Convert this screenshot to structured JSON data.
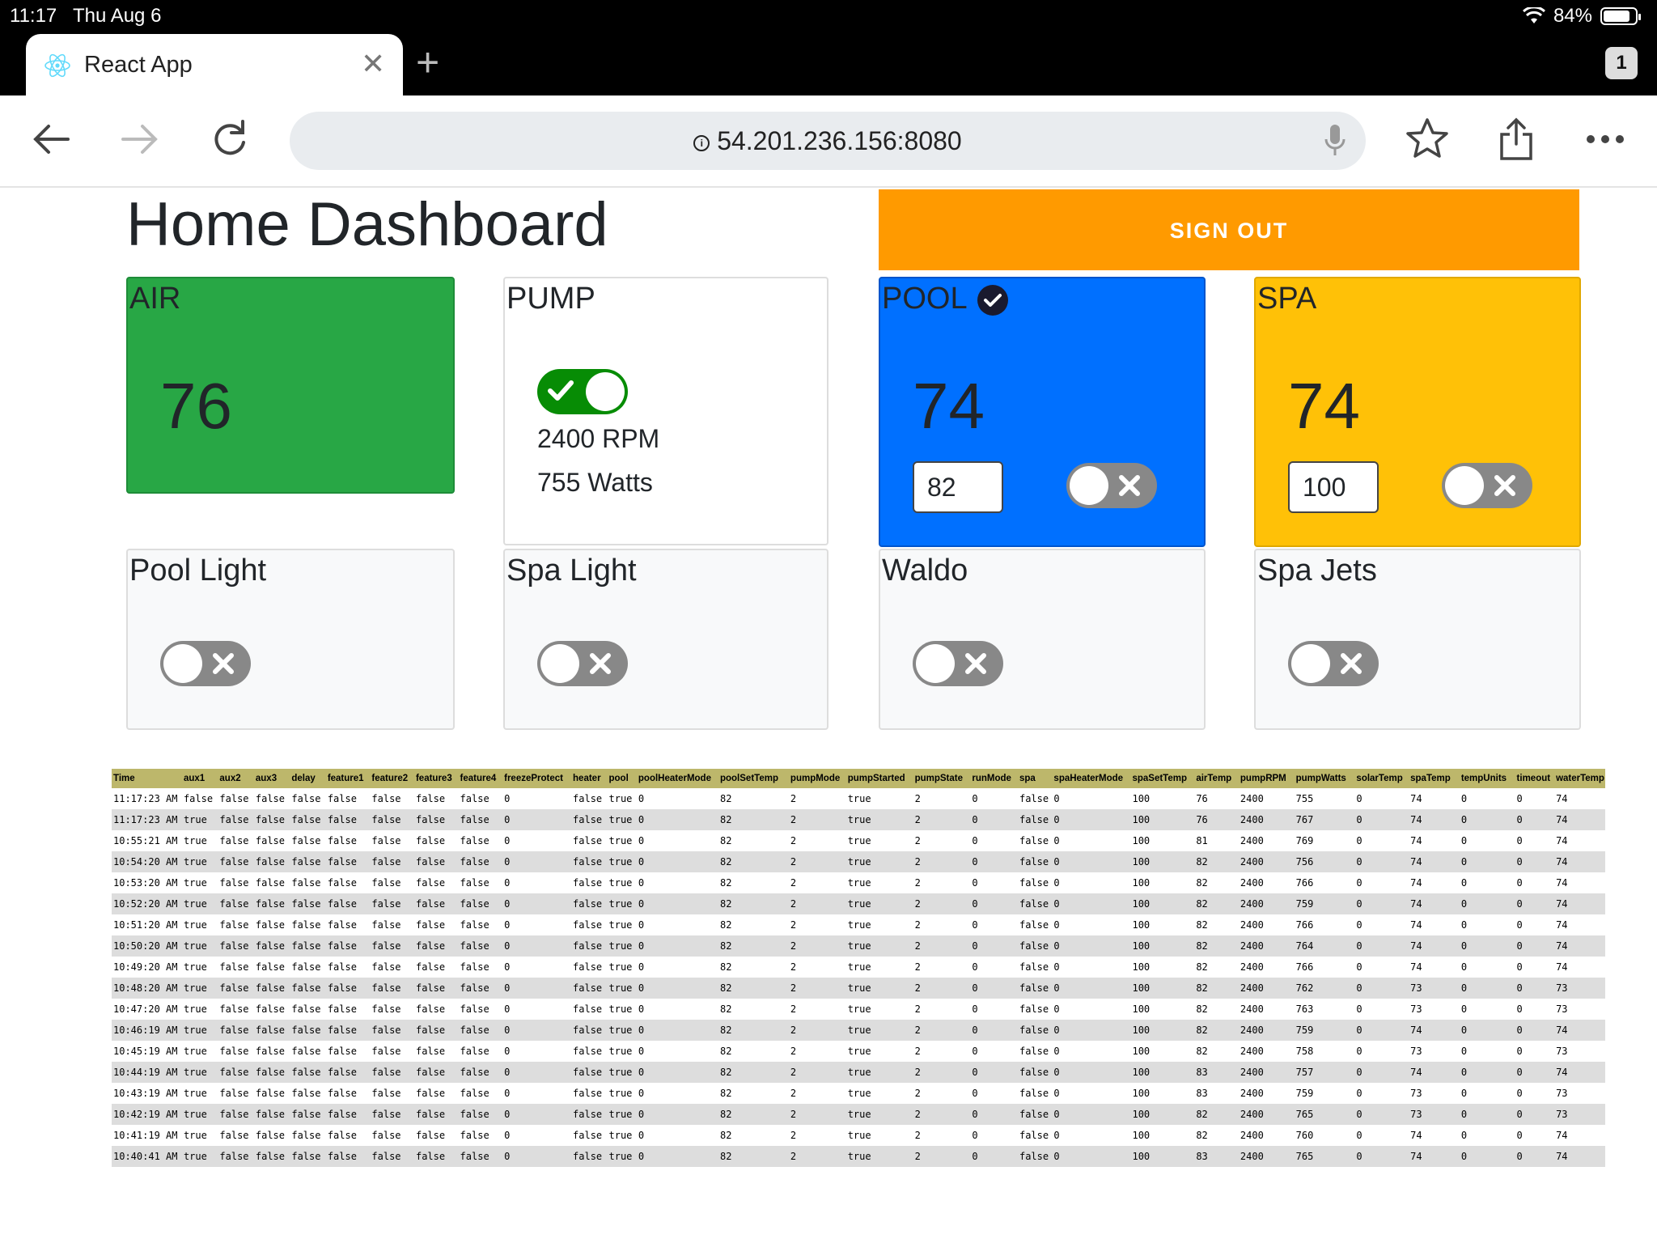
{
  "status_bar": {
    "time": "11:17",
    "date": "Thu Aug 6",
    "battery": "84%"
  },
  "browser": {
    "tab_title": "React App",
    "tab_count": "1",
    "url": "54.201.236.156:8080"
  },
  "page": {
    "title": "Home Dashboard",
    "signout_label": "SIGN OUT"
  },
  "cards": {
    "air": {
      "label": "AIR",
      "temp": "76",
      "color": "#28a745"
    },
    "pump": {
      "label": "PUMP",
      "on": true,
      "rpm": "2400 RPM",
      "watts": "755 Watts"
    },
    "pool": {
      "label": "POOL",
      "temp": "74",
      "set_temp": "82",
      "on": false,
      "active": true,
      "color": "#0070ff"
    },
    "spa": {
      "label": "SPA",
      "temp": "74",
      "set_temp": "100",
      "on": false,
      "color": "#ffc107"
    },
    "pool_light": {
      "label": "Pool Light",
      "on": false
    },
    "spa_light": {
      "label": "Spa Light",
      "on": false
    },
    "waldo": {
      "label": "Waldo",
      "on": false
    },
    "spa_jets": {
      "label": "Spa Jets",
      "on": false
    }
  },
  "history": {
    "columns": [
      "Time",
      "aux1",
      "aux2",
      "aux3",
      "delay",
      "feature1",
      "feature2",
      "feature3",
      "feature4",
      "freezeProtect",
      "heater",
      "pool",
      "poolHeaterMode",
      "poolSetTemp",
      "pumpMode",
      "pumpStarted",
      "pumpState",
      "runMode",
      "spa",
      "spaHeaterMode",
      "spaSetTemp",
      "airTemp",
      "pumpRPM",
      "pumpWatts",
      "solarTemp",
      "spaTemp",
      "tempUnits",
      "timeout",
      "waterTemp"
    ],
    "rows": [
      [
        "11:17:23 AM",
        "false",
        "false",
        "false",
        "false",
        "false",
        "false",
        "false",
        "false",
        "0",
        "false",
        "true",
        "0",
        "82",
        "2",
        "true",
        "2",
        "0",
        "false",
        "0",
        "100",
        "76",
        "2400",
        "755",
        "0",
        "74",
        "0",
        "0",
        "74"
      ],
      [
        "11:17:23 AM",
        "true",
        "false",
        "false",
        "false",
        "false",
        "false",
        "false",
        "false",
        "0",
        "false",
        "true",
        "0",
        "82",
        "2",
        "true",
        "2",
        "0",
        "false",
        "0",
        "100",
        "76",
        "2400",
        "767",
        "0",
        "74",
        "0",
        "0",
        "74"
      ],
      [
        "10:55:21 AM",
        "true",
        "false",
        "false",
        "false",
        "false",
        "false",
        "false",
        "false",
        "0",
        "false",
        "true",
        "0",
        "82",
        "2",
        "true",
        "2",
        "0",
        "false",
        "0",
        "100",
        "81",
        "2400",
        "769",
        "0",
        "74",
        "0",
        "0",
        "74"
      ],
      [
        "10:54:20 AM",
        "true",
        "false",
        "false",
        "false",
        "false",
        "false",
        "false",
        "false",
        "0",
        "false",
        "true",
        "0",
        "82",
        "2",
        "true",
        "2",
        "0",
        "false",
        "0",
        "100",
        "82",
        "2400",
        "756",
        "0",
        "74",
        "0",
        "0",
        "74"
      ],
      [
        "10:53:20 AM",
        "true",
        "false",
        "false",
        "false",
        "false",
        "false",
        "false",
        "false",
        "0",
        "false",
        "true",
        "0",
        "82",
        "2",
        "true",
        "2",
        "0",
        "false",
        "0",
        "100",
        "82",
        "2400",
        "766",
        "0",
        "74",
        "0",
        "0",
        "74"
      ],
      [
        "10:52:20 AM",
        "true",
        "false",
        "false",
        "false",
        "false",
        "false",
        "false",
        "false",
        "0",
        "false",
        "true",
        "0",
        "82",
        "2",
        "true",
        "2",
        "0",
        "false",
        "0",
        "100",
        "82",
        "2400",
        "759",
        "0",
        "74",
        "0",
        "0",
        "74"
      ],
      [
        "10:51:20 AM",
        "true",
        "false",
        "false",
        "false",
        "false",
        "false",
        "false",
        "false",
        "0",
        "false",
        "true",
        "0",
        "82",
        "2",
        "true",
        "2",
        "0",
        "false",
        "0",
        "100",
        "82",
        "2400",
        "766",
        "0",
        "74",
        "0",
        "0",
        "74"
      ],
      [
        "10:50:20 AM",
        "true",
        "false",
        "false",
        "false",
        "false",
        "false",
        "false",
        "false",
        "0",
        "false",
        "true",
        "0",
        "82",
        "2",
        "true",
        "2",
        "0",
        "false",
        "0",
        "100",
        "82",
        "2400",
        "764",
        "0",
        "74",
        "0",
        "0",
        "74"
      ],
      [
        "10:49:20 AM",
        "true",
        "false",
        "false",
        "false",
        "false",
        "false",
        "false",
        "false",
        "0",
        "false",
        "true",
        "0",
        "82",
        "2",
        "true",
        "2",
        "0",
        "false",
        "0",
        "100",
        "82",
        "2400",
        "766",
        "0",
        "74",
        "0",
        "0",
        "74"
      ],
      [
        "10:48:20 AM",
        "true",
        "false",
        "false",
        "false",
        "false",
        "false",
        "false",
        "false",
        "0",
        "false",
        "true",
        "0",
        "82",
        "2",
        "true",
        "2",
        "0",
        "false",
        "0",
        "100",
        "82",
        "2400",
        "762",
        "0",
        "73",
        "0",
        "0",
        "73"
      ],
      [
        "10:47:20 AM",
        "true",
        "false",
        "false",
        "false",
        "false",
        "false",
        "false",
        "false",
        "0",
        "false",
        "true",
        "0",
        "82",
        "2",
        "true",
        "2",
        "0",
        "false",
        "0",
        "100",
        "82",
        "2400",
        "763",
        "0",
        "73",
        "0",
        "0",
        "73"
      ],
      [
        "10:46:19 AM",
        "true",
        "false",
        "false",
        "false",
        "false",
        "false",
        "false",
        "false",
        "0",
        "false",
        "true",
        "0",
        "82",
        "2",
        "true",
        "2",
        "0",
        "false",
        "0",
        "100",
        "82",
        "2400",
        "759",
        "0",
        "74",
        "0",
        "0",
        "74"
      ],
      [
        "10:45:19 AM",
        "true",
        "false",
        "false",
        "false",
        "false",
        "false",
        "false",
        "false",
        "0",
        "false",
        "true",
        "0",
        "82",
        "2",
        "true",
        "2",
        "0",
        "false",
        "0",
        "100",
        "82",
        "2400",
        "758",
        "0",
        "73",
        "0",
        "0",
        "73"
      ],
      [
        "10:44:19 AM",
        "true",
        "false",
        "false",
        "false",
        "false",
        "false",
        "false",
        "false",
        "0",
        "false",
        "true",
        "0",
        "82",
        "2",
        "true",
        "2",
        "0",
        "false",
        "0",
        "100",
        "83",
        "2400",
        "757",
        "0",
        "74",
        "0",
        "0",
        "74"
      ],
      [
        "10:43:19 AM",
        "true",
        "false",
        "false",
        "false",
        "false",
        "false",
        "false",
        "false",
        "0",
        "false",
        "true",
        "0",
        "82",
        "2",
        "true",
        "2",
        "0",
        "false",
        "0",
        "100",
        "83",
        "2400",
        "759",
        "0",
        "73",
        "0",
        "0",
        "73"
      ],
      [
        "10:42:19 AM",
        "true",
        "false",
        "false",
        "false",
        "false",
        "false",
        "false",
        "false",
        "0",
        "false",
        "true",
        "0",
        "82",
        "2",
        "true",
        "2",
        "0",
        "false",
        "0",
        "100",
        "82",
        "2400",
        "765",
        "0",
        "73",
        "0",
        "0",
        "73"
      ],
      [
        "10:41:19 AM",
        "true",
        "false",
        "false",
        "false",
        "false",
        "false",
        "false",
        "false",
        "0",
        "false",
        "true",
        "0",
        "82",
        "2",
        "true",
        "2",
        "0",
        "false",
        "0",
        "100",
        "82",
        "2400",
        "760",
        "0",
        "74",
        "0",
        "0",
        "74"
      ],
      [
        "10:40:41 AM",
        "true",
        "false",
        "false",
        "false",
        "false",
        "false",
        "false",
        "false",
        "0",
        "false",
        "true",
        "0",
        "82",
        "2",
        "true",
        "2",
        "0",
        "false",
        "0",
        "100",
        "83",
        "2400",
        "765",
        "0",
        "74",
        "0",
        "0",
        "74"
      ]
    ]
  }
}
